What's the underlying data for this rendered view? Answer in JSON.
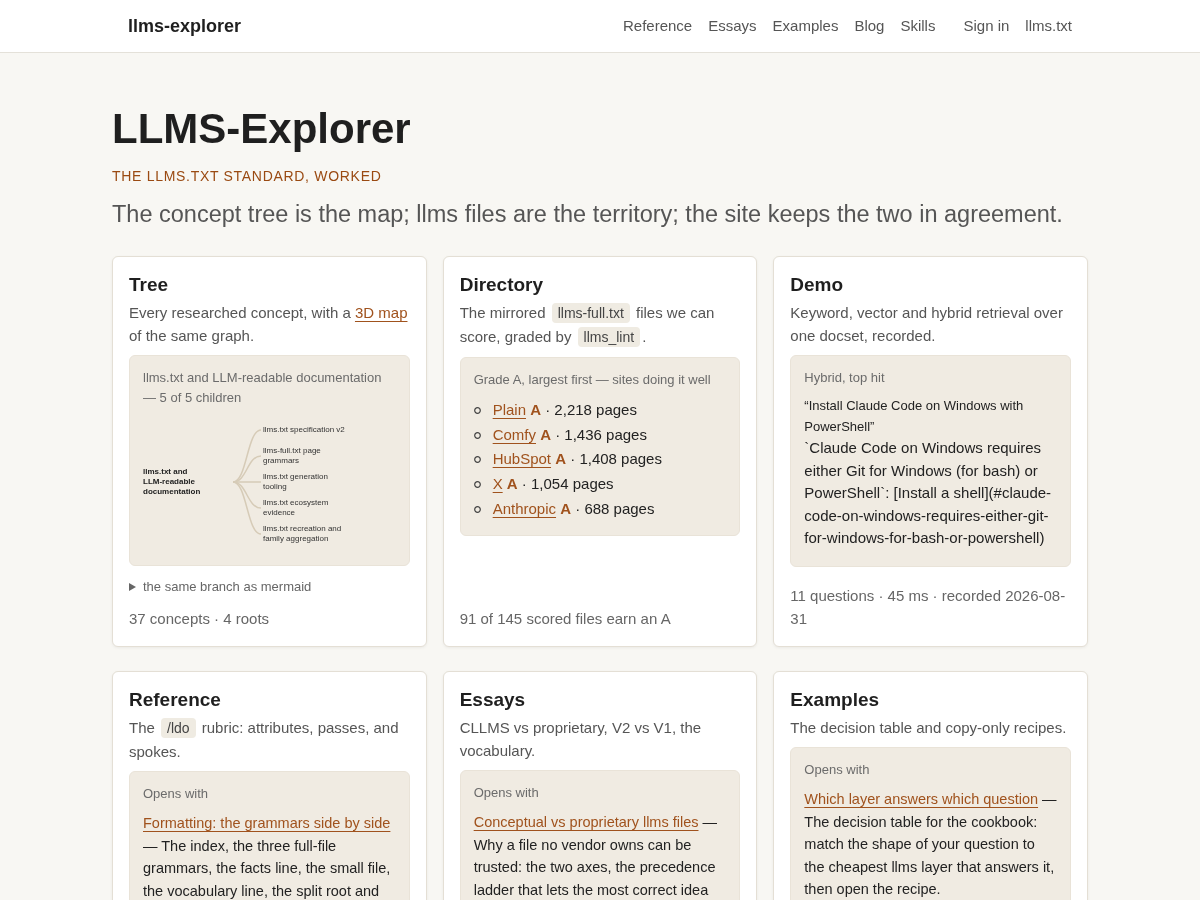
{
  "header": {
    "logo": "llms-explorer",
    "nav": [
      {
        "label": "Reference"
      },
      {
        "label": "Essays"
      },
      {
        "label": "Examples"
      },
      {
        "label": "Blog"
      },
      {
        "label": "Skills"
      }
    ],
    "account_links": [
      {
        "label": "Sign in"
      },
      {
        "label": "llms.txt"
      }
    ]
  },
  "hero": {
    "title": "LLMS-Explorer",
    "eyebrow": "THE LLMS.TXT STANDARD, WORKED",
    "tagline": "The concept tree is the map; llms files are the territory; the site keeps the two in agreement."
  },
  "cards": [
    {
      "kind": "tree",
      "title": "Tree",
      "description": [
        {
          "kind": "text",
          "text": "Every researched concept, with a "
        },
        {
          "kind": "link",
          "text": "3D map"
        },
        {
          "kind": "text",
          "text": " of the same graph."
        }
      ],
      "panel": {
        "caption": "llms.txt and LLM-readable documentation — 5 of 5 children",
        "mindmap": {
          "label": "llms.txt and LLM-readable documentation",
          "children": [
            {
              "label": "llms.txt specification v2"
            },
            {
              "label": "llms-full.txt page grammars"
            },
            {
              "label": "llms.txt generation tooling"
            },
            {
              "label": "llms.txt ecosystem evidence"
            },
            {
              "label": "llms.txt recreation and family aggregation"
            }
          ]
        }
      },
      "disclosure": {
        "label": "the same branch as mermaid",
        "expanded": false
      },
      "footer": "37 concepts · 4 roots"
    },
    {
      "kind": "directory",
      "title": "Directory",
      "description": [
        {
          "kind": "text",
          "text": "The mirrored "
        },
        {
          "kind": "code",
          "text": "llms-full.txt"
        },
        {
          "kind": "text",
          "text": " files we can score, graded by "
        },
        {
          "kind": "code",
          "text": "llms_lint"
        },
        {
          "kind": "text",
          "text": "."
        }
      ],
      "panel": {
        "caption": "Grade A, largest first — sites doing it well",
        "sites": [
          {
            "name": "Plain",
            "grade": "A",
            "detail": "· 2,218 pages"
          },
          {
            "name": "Comfy",
            "grade": "A",
            "detail": "· 1,436 pages"
          },
          {
            "name": "HubSpot",
            "grade": "A",
            "detail": "· 1,408 pages"
          },
          {
            "name": "X",
            "grade": "A",
            "detail": "· 1,054 pages"
          },
          {
            "name": "Anthropic",
            "grade": "A",
            "detail": "· 688 pages"
          }
        ]
      },
      "footer": "91 of 145 scored files earn an A"
    },
    {
      "kind": "demo",
      "title": "Demo",
      "description": [
        {
          "kind": "text",
          "text": "Keyword, vector and hybrid retrieval over one docset, recorded."
        }
      ],
      "panel": {
        "caption": "Hybrid, top hit",
        "question": "“Install Claude Code on Windows with PowerShell”",
        "answer": "`Claude Code on Windows requires either Git for Windows (for bash) or PowerShell`: [Install a shell](#claude-code-on-windows-requires-either-git-for-windows-for-bash-or-powershell)"
      },
      "footer": "11 questions · 45 ms · recorded 2026-08-31"
    },
    {
      "kind": "opens_with",
      "title": "Reference",
      "description": [
        {
          "kind": "text",
          "text": "The "
        },
        {
          "kind": "code",
          "text": "/ldo"
        },
        {
          "kind": "text",
          "text": " rubric: attributes, passes, and spokes."
        }
      ],
      "panel": {
        "caption": "Opens with",
        "link": "Formatting: the grammars side by side",
        "summary": "— The index, the three full-file grammars, the facts line, the small file, the vocabulary line, the split root and"
      }
    },
    {
      "kind": "opens_with",
      "title": "Essays",
      "description": [
        {
          "kind": "text",
          "text": "CLLMS vs proprietary, V2 vs V1, the vocabulary."
        }
      ],
      "panel": {
        "caption": "Opens with",
        "link": "Conceptual vs proprietary llms files",
        "summary": "— Why a file no vendor owns can be trusted: the two axes, the precedence ladder that lets the most correct idea"
      }
    },
    {
      "kind": "opens_with",
      "title": "Examples",
      "description": [
        {
          "kind": "text",
          "text": "The decision table and copy-only recipes."
        }
      ],
      "panel": {
        "caption": "Opens with",
        "link": "Which layer answers which question",
        "summary": "— The decision table for the cookbook: match the shape of your question to the cheapest llms layer that answers it, then open the recipe."
      }
    }
  ]
}
